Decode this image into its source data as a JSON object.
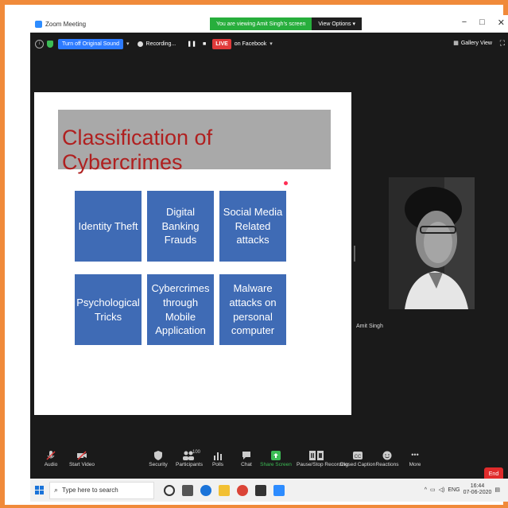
{
  "window": {
    "title": "Zoom Meeting",
    "share_banner": "You are viewing Amit Singh's screen",
    "view_options": "View Options",
    "controls": [
      "−",
      "□",
      "✕"
    ]
  },
  "top_toolbar": {
    "original_sound": "Turn off Original Sound",
    "recording": "Recording...",
    "live": "LIVE",
    "facebook": "on Facebook",
    "gallery_view": "Gallery View"
  },
  "slide": {
    "title": "Classification of  Cybercrimes",
    "boxes": [
      "Identity Theft",
      "Digital Banking Frauds",
      "Social Media Related attacks",
      "Psychological Tricks",
      "Cybercrimes through Mobile Application",
      "Malware attacks on personal computer"
    ]
  },
  "participant": {
    "name": "Amit Singh"
  },
  "toolbar": {
    "audio": "Audio",
    "video": "Start Video",
    "security": "Security",
    "participants": "Participants",
    "participants_count": "100",
    "polls": "Polls",
    "chat": "Chat",
    "share": "Share Screen",
    "record": "Pause/Stop Recording",
    "caption": "Closed Caption",
    "reactions": "Reactions",
    "more": "More",
    "end": "End"
  },
  "taskbar": {
    "search_placeholder": "Type here to search",
    "lang": "ENG",
    "time": "16:44",
    "date": "07-06-2020"
  },
  "colors": {
    "accent": "#2d8cff",
    "slide_box": "#3f6bb5",
    "slide_title": "#b02020",
    "frame": "#f08a3a"
  }
}
